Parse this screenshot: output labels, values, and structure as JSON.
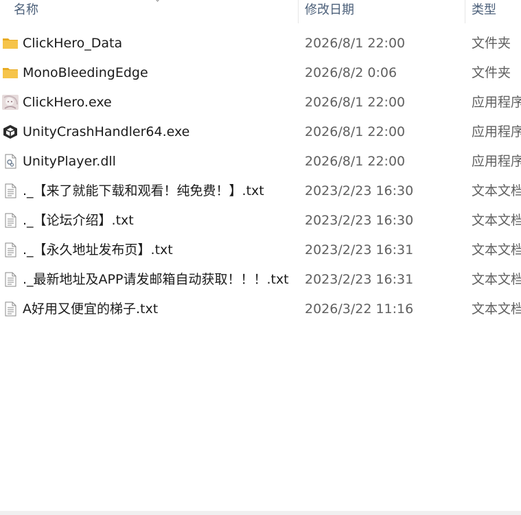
{
  "columns": {
    "name": "名称",
    "date": "修改日期",
    "type": "类型"
  },
  "colors": {
    "folder": "#f6c44a",
    "folder_dark": "#e8ab22",
    "header_text": "#4c607a",
    "row_text": "#1b1b1b",
    "meta_text": "#606060"
  },
  "files": [
    {
      "name": "ClickHero_Data",
      "date": "2026/8/1 22:00",
      "type": "文件夹",
      "icon": "folder-icon"
    },
    {
      "name": "MonoBleedingEdge",
      "date": "2026/8/2 0:06",
      "type": "文件夹",
      "icon": "folder-icon"
    },
    {
      "name": "ClickHero.exe",
      "date": "2026/8/1 22:00",
      "type": "应用程序",
      "icon": "app-thumbnail-icon"
    },
    {
      "name": "UnityCrashHandler64.exe",
      "date": "2026/8/1 22:00",
      "type": "应用程序",
      "icon": "unity-logo-icon"
    },
    {
      "name": "UnityPlayer.dll",
      "date": "2026/8/1 22:00",
      "type": "应用程序",
      "icon": "dll-file-icon"
    },
    {
      "name": "._【来了就能下载和观看！纯免费！】.txt",
      "date": "2023/2/23 16:30",
      "type": "文本文档",
      "icon": "text-file-icon"
    },
    {
      "name": "._【论坛介绍】.txt",
      "date": "2023/2/23 16:30",
      "type": "文本文档",
      "icon": "text-file-icon"
    },
    {
      "name": "._【永久地址发布页】.txt",
      "date": "2023/2/23 16:31",
      "type": "文本文档",
      "icon": "text-file-icon"
    },
    {
      "name": "._最新地址及APP请发邮箱自动获取！！！.txt",
      "date": "2023/2/23 16:31",
      "type": "文本文档",
      "icon": "text-file-icon"
    },
    {
      "name": "A好用又便宜的梯子.txt",
      "date": "2026/3/22 11:16",
      "type": "文本文档",
      "icon": "text-file-icon"
    }
  ]
}
